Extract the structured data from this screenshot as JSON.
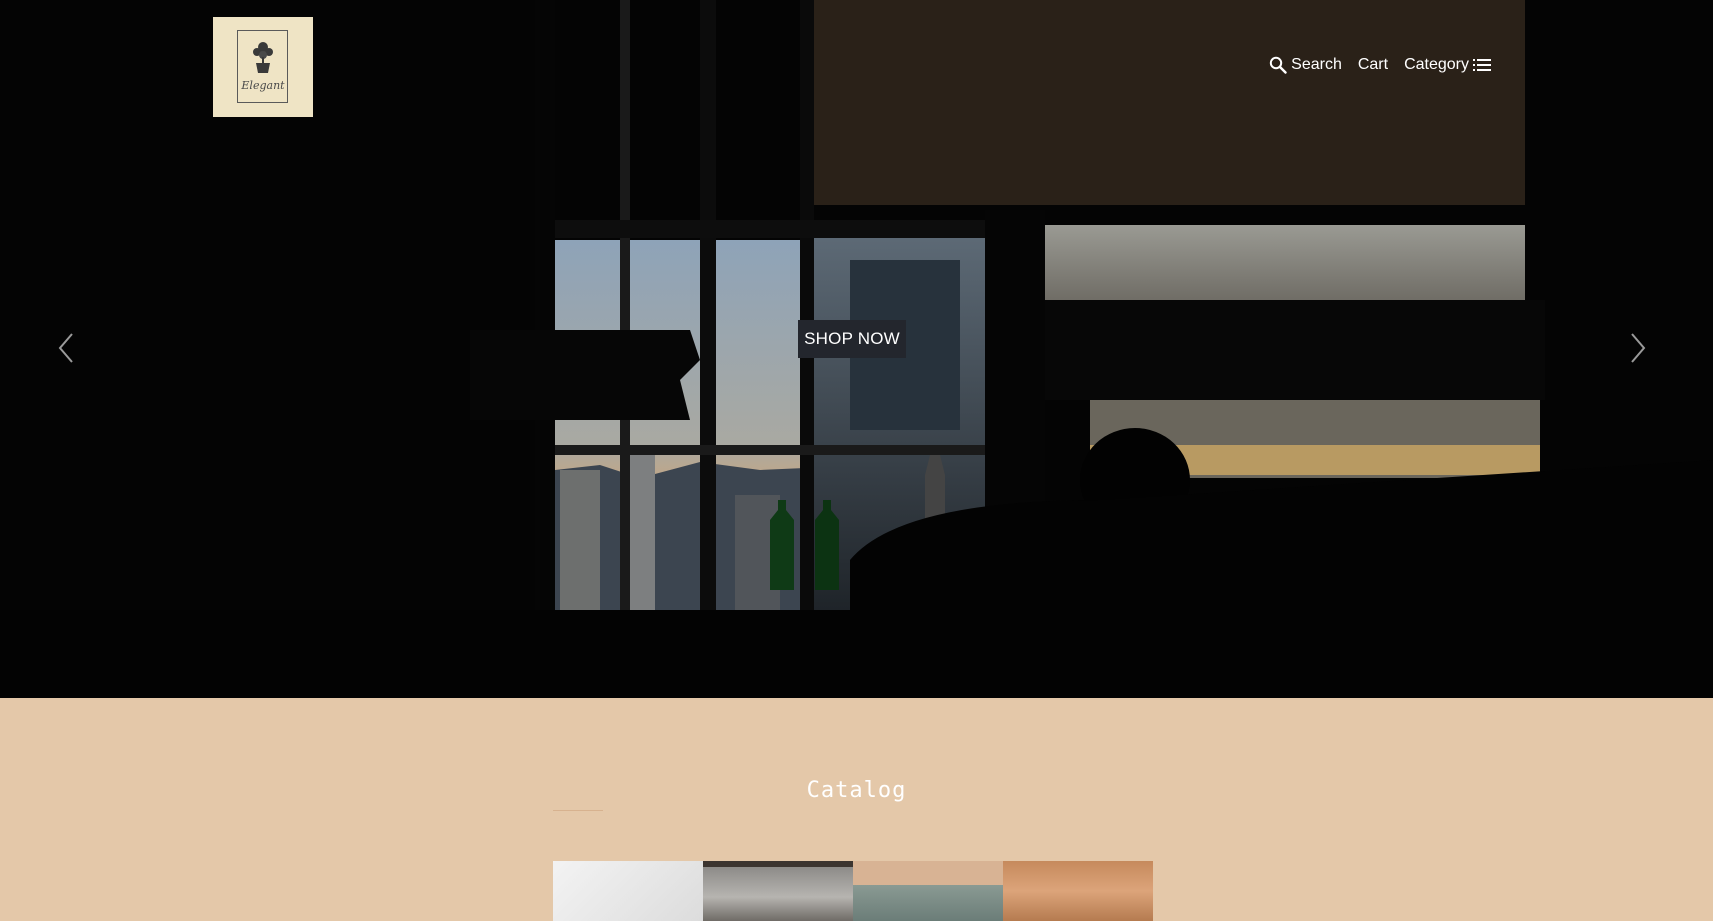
{
  "header": {
    "logo_text": "Elegant",
    "nav": {
      "search_label": "Search",
      "cart_label": "Cart",
      "category_label": "Category"
    }
  },
  "hero": {
    "cta_label": "SHOP NOW"
  },
  "catalog": {
    "title": "Catalog"
  },
  "icons": {
    "search": "search-icon",
    "category": "list-icon",
    "prev": "chevron-left-icon",
    "next": "chevron-right-icon"
  },
  "colors": {
    "hero_bg": "#040404",
    "page_bg": "#e4c8a9",
    "button_bg": "#23262d",
    "logo_bg": "#efe4c5"
  }
}
